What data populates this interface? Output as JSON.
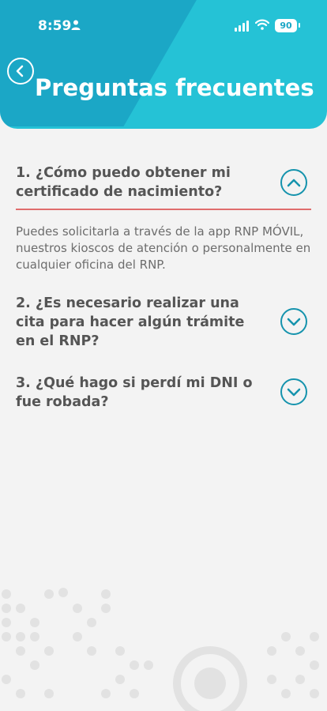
{
  "status_bar": {
    "time": "8:59",
    "battery": "90"
  },
  "header": {
    "title": "Preguntas frecuentes"
  },
  "faqs": [
    {
      "question": "1. ¿Cómo puedo obtener mi certificado de nacimiento?",
      "expanded": true,
      "answer": "Puedes solicitarla a través de la app RNP MÓVIL, nuestros kioscos de atención o personalmente en cualquier oficina del RNP."
    },
    {
      "question": "2. ¿Es necesario realizar una cita para hacer algún trámite en el RNP?",
      "expanded": false
    },
    {
      "question": "3. ¿Qué hago si perdí mi DNI o fue robada?",
      "expanded": false
    }
  ],
  "colors": {
    "header": "#25c2d6",
    "header_band": "#1ba7c6",
    "accent": "#1593ad",
    "divider": "#e06d6d"
  },
  "icons": [
    "person-icon",
    "signal-icon",
    "wifi-icon",
    "battery-icon",
    "back-arrow-icon",
    "chevron-up-icon",
    "chevron-down-icon"
  ]
}
